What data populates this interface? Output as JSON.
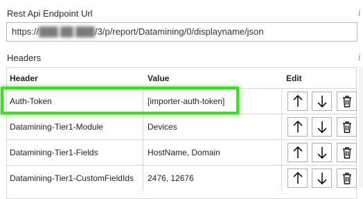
{
  "endpoint": {
    "label": "Rest Api Endpoint Url",
    "url_prefix": "https://",
    "url_redacted": "███.██.███",
    "url_suffix": "/3/p/report/Datamining/0/displayname/json",
    "info_icon": "info-icon"
  },
  "headers": {
    "label": "Headers",
    "info_icon": "info-icon",
    "columns": {
      "header": "Header",
      "value": "Value",
      "edit": "Edit"
    },
    "rows": [
      {
        "header": "Auth-Token",
        "value": "[importer-auth-token]"
      },
      {
        "header": "Datamining-Tier1-Module",
        "value": "Devices"
      },
      {
        "header": "Datamining-Tier1-Fields",
        "value": "HostName, Domain"
      },
      {
        "header": "Datamining-Tier1-CustomFieldIds",
        "value": "2476, 12676"
      }
    ],
    "row_actions": [
      "arrow-up-icon",
      "arrow-down-icon",
      "trash-icon"
    ]
  },
  "highlight_color": "#39e01c"
}
